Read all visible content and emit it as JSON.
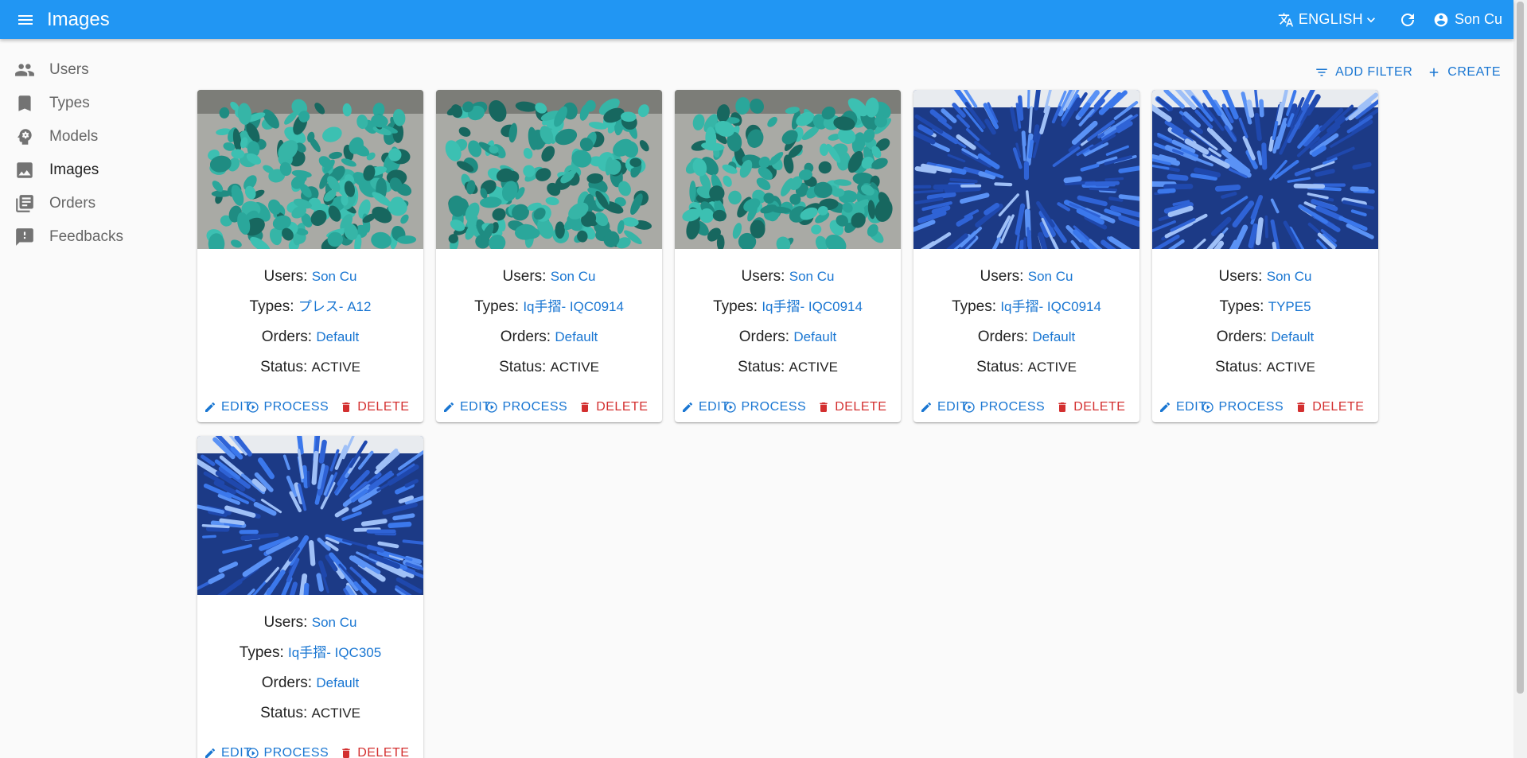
{
  "app": {
    "title": "Images",
    "language": "ENGLISH",
    "user": "Son Cu"
  },
  "sidebar": {
    "items": [
      {
        "label": "Users",
        "icon": "people-icon"
      },
      {
        "label": "Types",
        "icon": "bookmark-icon"
      },
      {
        "label": "Models",
        "icon": "psychology-icon"
      },
      {
        "label": "Images",
        "icon": "image-icon"
      },
      {
        "label": "Orders",
        "icon": "library-books-icon"
      },
      {
        "label": "Feedbacks",
        "icon": "feedback-icon"
      }
    ],
    "active": "Images"
  },
  "toolbar": {
    "add_filter": "ADD FILTER",
    "create": "CREATE"
  },
  "field_labels": {
    "users": "Users:",
    "types": "Types:",
    "orders": "Orders:",
    "status": "Status:"
  },
  "actions": {
    "edit": "EDIT",
    "process": "PROCESS",
    "delete": "DELETE"
  },
  "cards": [
    {
      "image": "teal-parts-photo",
      "user": "Son Cu",
      "type": "プレス- A12",
      "order": "Default",
      "status": "ACTIVE"
    },
    {
      "image": "teal-parts-photo",
      "user": "Son Cu",
      "type": "Iq手摺- IQC0914",
      "order": "Default",
      "status": "ACTIVE"
    },
    {
      "image": "teal-parts-photo",
      "user": "Son Cu",
      "type": "Iq手摺- IQC0914",
      "order": "Default",
      "status": "ACTIVE"
    },
    {
      "image": "blue-parts-photo",
      "user": "Son Cu",
      "type": "Iq手摺- IQC0914",
      "order": "Default",
      "status": "ACTIVE"
    },
    {
      "image": "blue-parts-photo",
      "user": "Son Cu",
      "type": "TYPE5",
      "order": "Default",
      "status": "ACTIVE"
    },
    {
      "image": "blue-parts-photo",
      "user": "Son Cu",
      "type": "Iq手摺- IQC305",
      "order": "Default",
      "status": "ACTIVE"
    }
  ],
  "colors": {
    "primary": "#2196f3",
    "link": "#1976d2",
    "danger": "#d32f2f",
    "teal": "#2aa79b",
    "blue": "#2f63d6"
  }
}
